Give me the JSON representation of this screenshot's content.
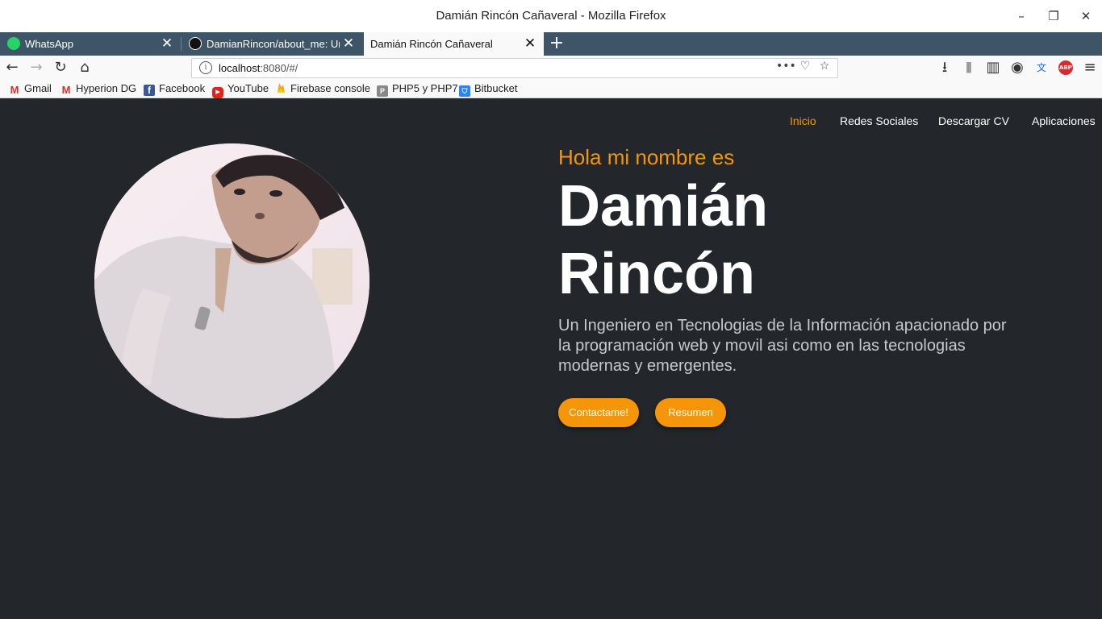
{
  "window": {
    "title": "Damián Rincón Cañaveral - Mozilla Firefox",
    "controls": {
      "minimize": "–",
      "restore": "❐",
      "close": "✕"
    }
  },
  "tabs": [
    {
      "title": "WhatsApp",
      "icon": "whatsapp-icon",
      "active": false
    },
    {
      "title": "DamianRincon/about_me: Un",
      "icon": "github-icon",
      "active": false
    },
    {
      "title": "Damián Rincón Cañaveral",
      "icon": "",
      "active": true
    }
  ],
  "newtab_label": "+",
  "close_glyph": "✕",
  "navigation": {
    "back": "←",
    "forward": "→",
    "reload": "↻",
    "home": "⌂",
    "url_host": "localhost",
    "url_rest": ":8080/#/",
    "url_actions": {
      "more": "•••",
      "pocket": "♡",
      "bookmark": "☆"
    },
    "toolbar_icons": {
      "download": "⭳",
      "library": "⫼",
      "sidebar": "▥",
      "account": "◉",
      "translate": "文",
      "adblock": "ABP",
      "menu": "≡"
    }
  },
  "bookmarks": [
    {
      "label": "Gmail",
      "icon": "gmail-icon",
      "color": "#d93025",
      "glyph": "M"
    },
    {
      "label": "Hyperion DG",
      "icon": "gmail-icon",
      "color": "#d93025",
      "glyph": "M"
    },
    {
      "label": "Facebook",
      "icon": "facebook-icon",
      "color": "#3b5998",
      "glyph": "f"
    },
    {
      "label": "YouTube",
      "icon": "youtube-icon",
      "color": "#e62117",
      "glyph": "▶"
    },
    {
      "label": "Firebase console",
      "icon": "firebase-icon",
      "color": "#f5a623",
      "glyph": "🔥"
    },
    {
      "label": "PHP5 y PHP7",
      "icon": "php-icon",
      "color": "#777",
      "glyph": "P"
    },
    {
      "label": "Bitbucket",
      "icon": "bitbucket-icon",
      "color": "#2684ff",
      "glyph": "⛉"
    }
  ],
  "site": {
    "nav": [
      "Inicio",
      "Redes Sociales",
      "Descargar CV",
      "Aplicaciones"
    ],
    "greeting": "Hola mi nombre es",
    "name_line1": "Damián",
    "name_line2": "Rincón",
    "description": "Un Ingeniero en Tecnologias de la Información apacionado por la programación web y movil asi como en las tecnologias modernas y emergentes.",
    "buttons": {
      "contact": "Contactame!",
      "summary": "Resumen"
    },
    "accent_color": "#f5960a",
    "background_color": "#23272b"
  }
}
